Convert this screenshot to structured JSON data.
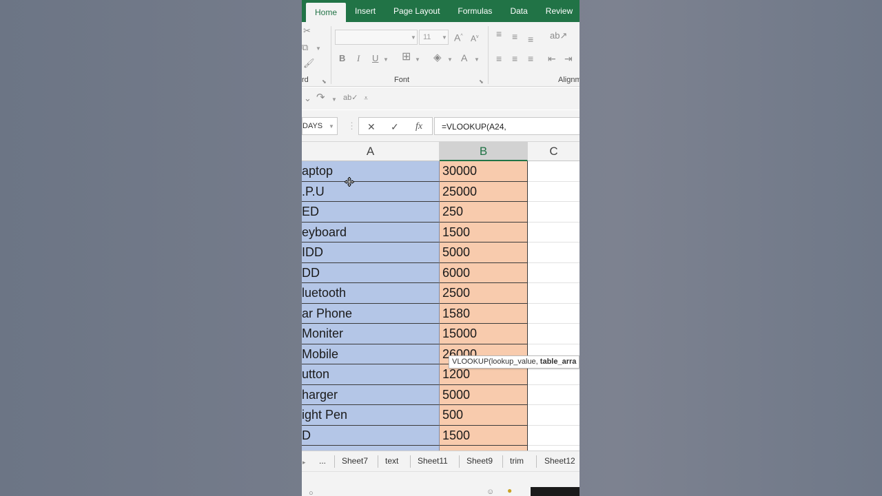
{
  "ribbon": {
    "tabs": [
      "Home",
      "Insert",
      "Page Layout",
      "Formulas",
      "Data",
      "Review"
    ],
    "active_tab": "Home",
    "clipboard_label": "rd",
    "font_group_label": "Font",
    "alignment_group_label": "Alignm",
    "font_size": "11",
    "bold": "B",
    "italic": "I",
    "underline": "U"
  },
  "formula_bar": {
    "name_box": "DAYS",
    "fx": "fx",
    "formula": "=VLOOKUP(A24,"
  },
  "columns": [
    "A",
    "B",
    "C"
  ],
  "rows": [
    {
      "a": "aptop",
      "b": "30000"
    },
    {
      "a": ".P.U",
      "b": "25000"
    },
    {
      "a": "ED",
      "b": "250"
    },
    {
      "a": "eyboard",
      "b": "1500"
    },
    {
      "a": "IDD",
      "b": "5000"
    },
    {
      "a": "DD",
      "b": "6000"
    },
    {
      "a": "luetooth",
      "b": "2500"
    },
    {
      "a": "ar Phone",
      "b": "1580"
    },
    {
      "a": "Moniter",
      "b": "15000"
    },
    {
      "a": "Mobile",
      "b": "26000"
    },
    {
      "a": "utton",
      "b": "1200"
    },
    {
      "a": "harger",
      "b": "5000"
    },
    {
      "a": "ight Pen",
      "b": "500"
    },
    {
      "a": "D",
      "b": "1500"
    }
  ],
  "tooltip": {
    "prefix": "VLOOKUP(lookup_value, ",
    "bold": "table_arra"
  },
  "sheets": [
    "...",
    "Sheet7",
    "text",
    "Sheet11",
    "Sheet9",
    "trim",
    "Sheet12"
  ],
  "colors": {
    "accent": "#217346",
    "col_a_fill": "#b4c6e7",
    "col_b_fill": "#f8cbad"
  }
}
